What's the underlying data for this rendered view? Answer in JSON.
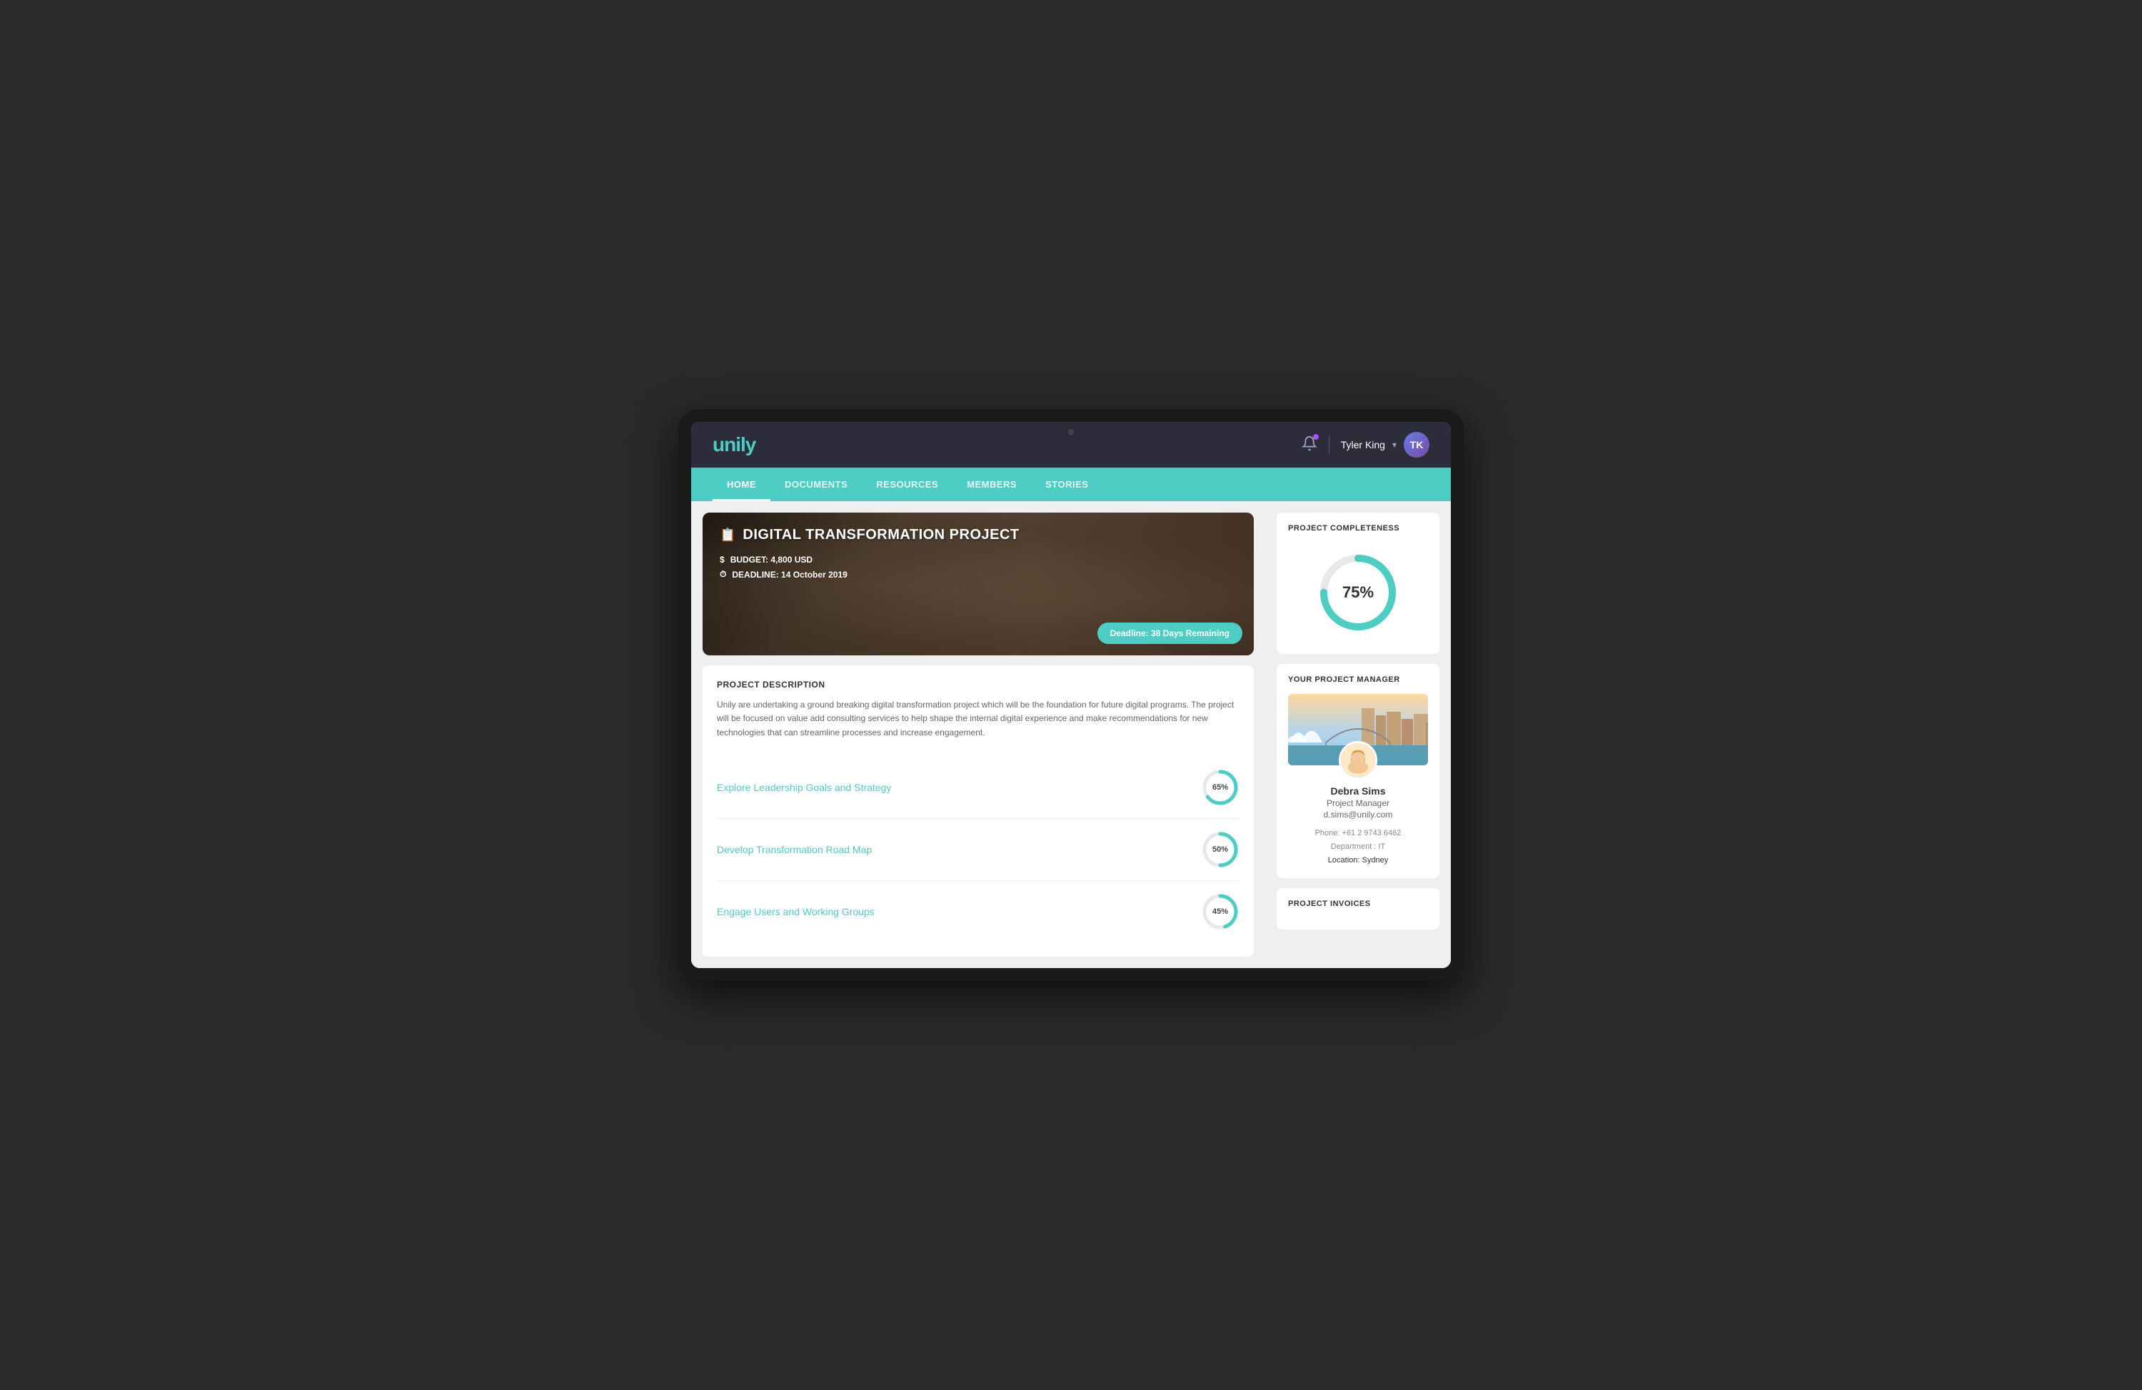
{
  "device": {
    "topDot": "camera"
  },
  "header": {
    "logo": "unily",
    "notification_icon": "bell",
    "notification_dot_color": "#a855f7",
    "user_name": "Tyler King",
    "user_avatar_initials": "TK"
  },
  "nav": {
    "items": [
      {
        "label": "HOME",
        "active": true
      },
      {
        "label": "DOCUMENTS",
        "active": false
      },
      {
        "label": "RESOURCES",
        "active": false
      },
      {
        "label": "MEMBERS",
        "active": false
      },
      {
        "label": "STORIES",
        "active": false
      }
    ]
  },
  "hero": {
    "title": "DIGITAL TRANSFORMATION PROJECT",
    "budget_label": "BUDGET: 4,800 USD",
    "deadline_label": "DEADLINE: 14 October 2019",
    "badge": "Deadline: 38 Days Remaining"
  },
  "project_description": {
    "section_title": "PROJECT DESCRIPTION",
    "text": "Unily are undertaking a ground breaking digital transformation project which will be the foundation for future digital programs. The project will be focused on value add consulting services to help shape the internal digital experience and make recommendations for new technologies that can streamline processes and increase engagement."
  },
  "goals": [
    {
      "label": "Explore Leadership Goals and Strategy",
      "percent": 65,
      "percent_label": "65%"
    },
    {
      "label": "Develop Transformation Road Map",
      "percent": 50,
      "percent_label": "50%"
    },
    {
      "label": "Engage Users and Working Groups",
      "percent": 45,
      "percent_label": "45%"
    }
  ],
  "project_completeness": {
    "title": "PROJECT COMPLETENESS",
    "percent": 75,
    "percent_label": "75%"
  },
  "project_manager": {
    "title": "YOUR PROJECT MANAGER",
    "name": "Debra Sims",
    "role": "Project Manager",
    "email": "d.sims@unily.com",
    "phone": "Phone: +61 2 9743 6462",
    "department": "Department : IT",
    "location": "Location:",
    "location_value": "Sydney"
  },
  "project_invoices": {
    "title": "PROJECT INVOICES"
  },
  "colors": {
    "teal": "#4ecdc4",
    "dark_header": "#2c2c3a",
    "nav_bg": "#4ecdc4",
    "text_dark": "#333333",
    "text_muted": "#666666"
  }
}
